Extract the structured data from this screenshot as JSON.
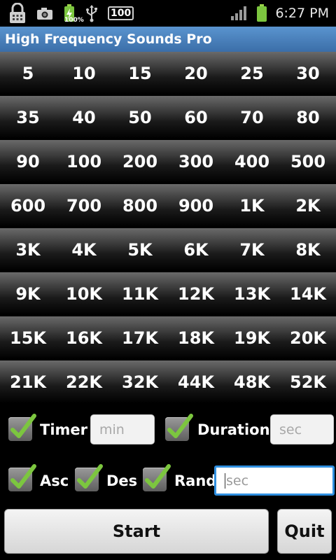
{
  "status_bar": {
    "battery_percent_label": "100%",
    "notification_count": "100",
    "time": "6:27 PM",
    "icons": [
      "lock-icon",
      "camera-icon",
      "battery-charging-icon",
      "usb-icon",
      "notification-count-icon",
      "signal-icon",
      "battery-icon"
    ]
  },
  "app": {
    "title": "High Frequency Sounds Pro"
  },
  "frequencies": [
    [
      "5",
      "10",
      "15",
      "20",
      "25",
      "30"
    ],
    [
      "35",
      "40",
      "50",
      "60",
      "70",
      "80"
    ],
    [
      "90",
      "100",
      "200",
      "300",
      "400",
      "500"
    ],
    [
      "600",
      "700",
      "800",
      "900",
      "1K",
      "2K"
    ],
    [
      "3K",
      "4K",
      "5K",
      "6K",
      "7K",
      "8K"
    ],
    [
      "9K",
      "10K",
      "11K",
      "12K",
      "13K",
      "14K"
    ],
    [
      "15K",
      "16K",
      "17K",
      "18K",
      "19K",
      "20K"
    ],
    [
      "21K",
      "22K",
      "32K",
      "44K",
      "48K",
      "52K"
    ]
  ],
  "options": {
    "timer_label": "Timer",
    "timer_placeholder": "min",
    "duration_label": "Duration",
    "duration_placeholder": "sec",
    "asc_label": "Asc",
    "des_label": "Des",
    "rand_label": "Rand",
    "rand_placeholder": "sec"
  },
  "actions": {
    "start_label": "Start",
    "quit_label": "Quit"
  },
  "colors": {
    "title_bar": "#4a82bd",
    "focus_border": "#2f8fe0",
    "check_mark": "#7cc63f"
  }
}
